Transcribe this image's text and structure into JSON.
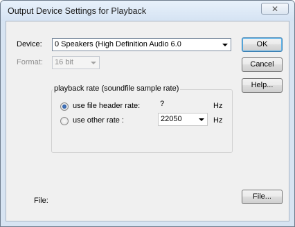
{
  "window": {
    "title": "Output Device Settings for Playback",
    "close_glyph": "✕"
  },
  "device": {
    "label": "Device:",
    "value": "0 Speakers (High Definition Audio 6.0"
  },
  "format": {
    "label": "Format:",
    "value": "16 bit"
  },
  "buttons": {
    "ok": "OK",
    "cancel": "Cancel",
    "help": "Help...",
    "file": "File..."
  },
  "playback_rate": {
    "group_title": "playback rate (soundfile sample rate)",
    "header_option": "use file header rate:",
    "header_value": "?",
    "header_unit": "Hz",
    "other_option": "use other rate :",
    "other_value": "22050",
    "other_unit": "Hz",
    "selected": "header"
  },
  "file": {
    "label": "File:"
  }
}
